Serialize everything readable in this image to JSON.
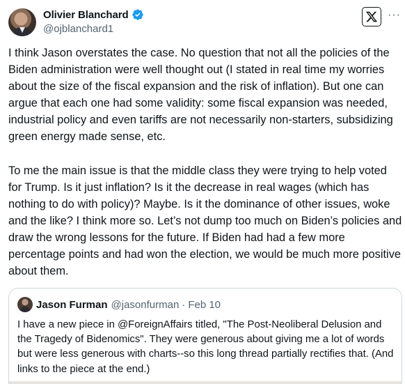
{
  "author": {
    "display_name": "Olivier Blanchard",
    "handle": "@ojblanchard1",
    "verified": true
  },
  "icons": {
    "verified": "verified-badge-icon",
    "brand": "x-logo-icon",
    "more": "more-options-icon",
    "more_glyph": "···"
  },
  "colors": {
    "verified_blue": "#1d9bf0",
    "text": "#0f1419",
    "secondary": "#536471",
    "border": "#cfd9de"
  },
  "tweet": {
    "paragraphs": [
      "I think Jason overstates the case. No question that not all the policies of the Biden administration were well thought out (I stated in real time my worries about the size of the fiscal expansion and the risk of inflation). But one can argue that each one had some validity: some fiscal expansion was needed, industrial policy and even tariffs are not necessarily non-starters, subsidizing green energy made sense, etc.",
      "To me the main issue is that the middle class they were trying to help voted for Trump. Is it just inflation? Is it the decrease in real wages (which has nothing to do with policy)? Maybe. Is it the dominance of other issues, woke and the like? I think more so. Let’s not dump too much on Biden’s policies and draw the wrong lessons for the future. If Biden had had a few more percentage points and had won the election, we would be much more positive about them."
    ]
  },
  "quote": {
    "display_name": "Jason Furman",
    "handle": "@jasonfurman",
    "separator": "·",
    "date": "Feb 10",
    "text": "I have a new piece in @ForeignAffairs titled, \"The Post-Neoliberal Delusion and the Tragedy of Bidenomics\". They were generous about giving me a lot of words but were less generous with charts--so this long thread partially rectifies that. (And links to the piece at the end.)"
  }
}
